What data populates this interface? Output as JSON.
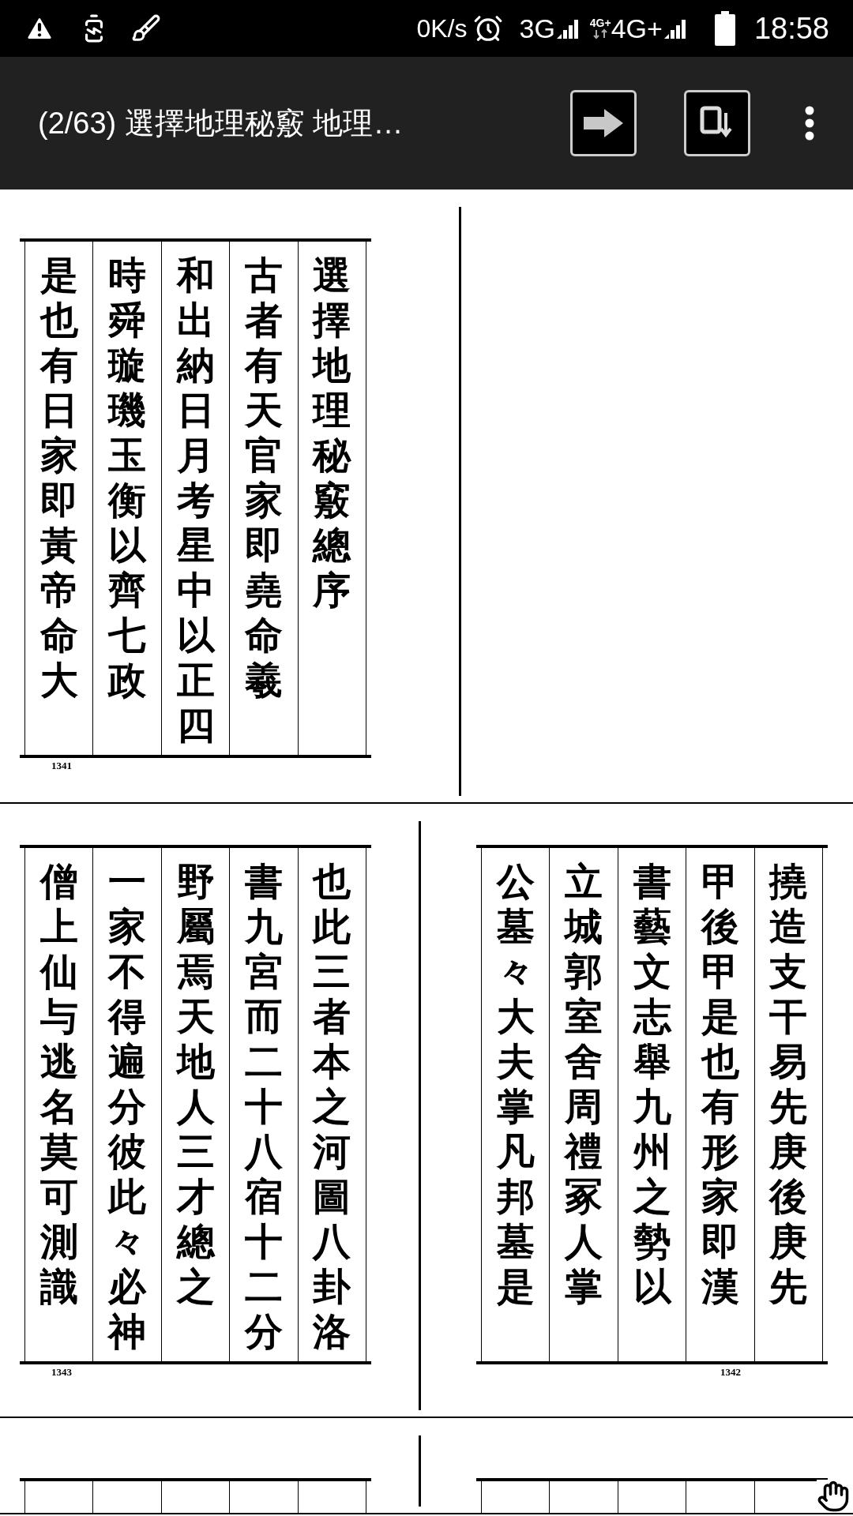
{
  "status_bar": {
    "speed": "0K/s",
    "network_1": "3G",
    "network_2_badge": "4G+",
    "network_2": "4G+",
    "time": "18:58"
  },
  "app_bar": {
    "title": "(2/63) 選擇地理秘竅 地理…"
  },
  "page_rows": [
    {
      "pages": [
        {
          "kind": "text",
          "page_number": "1341",
          "columns": [
            "是也有日家即黃帝命大",
            "時舜璇璣玉衡以齊七政",
            "和出納日月考星中以正四",
            "古者有天官家即堯命羲",
            "選擇地理秘竅總序"
          ]
        },
        {
          "kind": "blank"
        }
      ]
    },
    {
      "pages": [
        {
          "kind": "text",
          "page_number": "1343",
          "columns": [
            "僧上仙与逃名莫可測識",
            "一家不得遍分彼此々必神",
            "野屬焉天地人三才總之",
            "書九宮而二十八宿十二分",
            "也此三者本之河圖八卦洛"
          ]
        },
        {
          "kind": "text",
          "page_number": "1342",
          "columns": [
            "公墓々大夫掌凡邦墓是",
            "立城郭室舍周禮冢人掌",
            "書藝文志舉九州之勢以",
            "甲後甲是也有形家即漢",
            "撓造支干易先庚後庚先"
          ]
        }
      ]
    },
    {
      "pages": [
        {
          "kind": "cut"
        },
        {
          "kind": "cut"
        }
      ]
    }
  ]
}
